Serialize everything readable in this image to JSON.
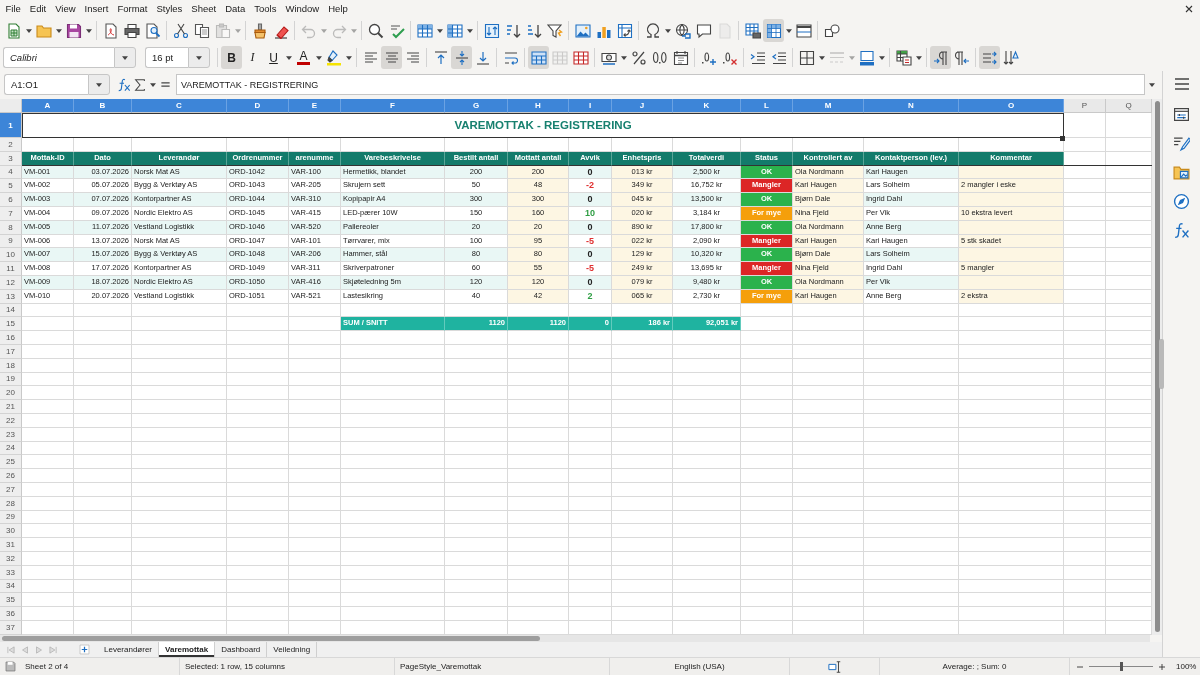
{
  "menu": [
    "File",
    "Edit",
    "View",
    "Insert",
    "Format",
    "Styles",
    "Sheet",
    "Data",
    "Tools",
    "Window",
    "Help"
  ],
  "standard_toolbar": [
    {
      "on": false,
      "disabled": false
    },
    {
      "on": false,
      "disabled": false
    },
    {
      "on": false,
      "disabled": false
    },
    {
      "on": false,
      "disabled": false
    },
    {
      "on": false,
      "disabled": false
    },
    {
      "on": false,
      "disabled": false
    },
    {
      "on": false,
      "disabled": false
    },
    {
      "on": false,
      "disabled": false
    },
    {
      "on": false,
      "disabled": true
    },
    {
      "on": false,
      "disabled": false
    },
    {
      "on": false,
      "disabled": false
    },
    {
      "on": false,
      "disabled": true
    },
    {
      "on": false,
      "disabled": true
    },
    {
      "on": false,
      "disabled": false
    },
    {
      "on": false,
      "disabled": false
    },
    {
      "on": false,
      "disabled": false
    },
    {
      "on": false,
      "disabled": false
    },
    {
      "on": false,
      "disabled": false
    },
    {
      "on": false,
      "disabled": false
    },
    {
      "on": false,
      "disabled": false
    },
    {
      "on": false,
      "disabled": false
    },
    {
      "on": false,
      "disabled": false
    },
    {
      "on": false,
      "disabled": false
    },
    {
      "on": false,
      "disabled": false
    },
    {
      "on": false,
      "disabled": false
    },
    {
      "on": false,
      "disabled": false
    },
    {
      "on": false,
      "disabled": false
    },
    {
      "on": false,
      "disabled": true
    },
    {
      "on": false,
      "disabled": false
    },
    {
      "on": true,
      "disabled": false
    },
    {
      "on": false,
      "disabled": false
    },
    {
      "on": false,
      "disabled": false
    }
  ],
  "formatting_toolbar": {
    "font_name": "Calibri",
    "font_size": "16 pt",
    "buttons": [
      {
        "label": "B",
        "on": true,
        "disabled": false
      },
      {
        "label": "I",
        "on": false,
        "disabled": false
      },
      {
        "label": "U",
        "on": false,
        "disabled": false
      },
      {
        "label": "A",
        "on": false,
        "disabled": false
      },
      {
        "on": false,
        "disabled": false
      },
      {
        "on": false,
        "disabled": false
      },
      {
        "on": true,
        "disabled": false
      },
      {
        "on": false,
        "disabled": false
      },
      {
        "on": false,
        "disabled": false
      },
      {
        "on": true,
        "disabled": false
      },
      {
        "on": false,
        "disabled": false
      },
      {
        "on": false,
        "disabled": false
      },
      {
        "on": true,
        "disabled": false
      },
      {
        "on": false,
        "disabled": true
      },
      {
        "on": false,
        "disabled": false
      },
      {
        "on": false,
        "disabled": false
      },
      {
        "on": false,
        "disabled": false
      },
      {
        "on": false,
        "disabled": false
      },
      {
        "on": false,
        "disabled": false
      },
      {
        "on": false,
        "disabled": false
      },
      {
        "on": false,
        "disabled": false
      },
      {
        "on": false,
        "disabled": false
      },
      {
        "on": false,
        "disabled": false
      },
      {
        "on": false,
        "disabled": false
      },
      {
        "on": false,
        "disabled": true
      },
      {
        "on": false,
        "disabled": false
      },
      {
        "on": false,
        "disabled": false
      },
      {
        "on": true,
        "disabled": false
      },
      {
        "on": false,
        "disabled": false
      },
      {
        "on": true,
        "disabled": false
      },
      {
        "on": false,
        "disabled": false
      }
    ]
  },
  "formula_bar": {
    "name_box": "A1:O1",
    "formula": "VAREMOTTAK - REGISTRERING"
  },
  "sheet": {
    "column_headers": [
      {
        "label": "A",
        "selected": true
      },
      {
        "label": "B",
        "selected": true
      },
      {
        "label": "C",
        "selected": true
      },
      {
        "label": "D",
        "selected": true
      },
      {
        "label": "E",
        "selected": true
      },
      {
        "label": "F",
        "selected": true
      },
      {
        "label": "G",
        "selected": true
      },
      {
        "label": "H",
        "selected": true
      },
      {
        "label": "I",
        "selected": true
      },
      {
        "label": "J",
        "selected": true
      },
      {
        "label": "K",
        "selected": true
      },
      {
        "label": "L",
        "selected": true
      },
      {
        "label": "M",
        "selected": true
      },
      {
        "label": "N",
        "selected": true
      },
      {
        "label": "O",
        "selected": true
      },
      {
        "label": "P",
        "selected": false
      },
      {
        "label": "Q",
        "selected": false
      }
    ],
    "row_headers": [
      {
        "label": "1",
        "selected": true
      },
      {
        "label": "2",
        "selected": false
      },
      {
        "label": "3",
        "selected": false
      },
      {
        "label": "4",
        "selected": false
      },
      {
        "label": "5",
        "selected": false
      },
      {
        "label": "6",
        "selected": false
      },
      {
        "label": "7",
        "selected": false
      },
      {
        "label": "8",
        "selected": false
      },
      {
        "label": "9",
        "selected": false
      },
      {
        "label": "10",
        "selected": false
      },
      {
        "label": "11",
        "selected": false
      },
      {
        "label": "12",
        "selected": false
      },
      {
        "label": "13",
        "selected": false
      },
      {
        "label": "14",
        "selected": false
      },
      {
        "label": "15",
        "selected": false
      },
      {
        "label": "16",
        "selected": false
      },
      {
        "label": "17",
        "selected": false
      },
      {
        "label": "18",
        "selected": false
      },
      {
        "label": "19",
        "selected": false
      },
      {
        "label": "20",
        "selected": false
      },
      {
        "label": "21",
        "selected": false
      },
      {
        "label": "22",
        "selected": false
      },
      {
        "label": "23",
        "selected": false
      },
      {
        "label": "24",
        "selected": false
      },
      {
        "label": "25",
        "selected": false
      },
      {
        "label": "26",
        "selected": false
      },
      {
        "label": "27",
        "selected": false
      },
      {
        "label": "28",
        "selected": false
      },
      {
        "label": "29",
        "selected": false
      },
      {
        "label": "30",
        "selected": false
      },
      {
        "label": "31",
        "selected": false
      },
      {
        "label": "32",
        "selected": false
      },
      {
        "label": "33",
        "selected": false
      },
      {
        "label": "34",
        "selected": false
      },
      {
        "label": "35",
        "selected": false
      },
      {
        "label": "36",
        "selected": false
      },
      {
        "label": "37",
        "selected": false
      }
    ],
    "title": {
      "text": "VAREMOTTAK - REGISTRERING",
      "selected": true
    },
    "columns": [
      {
        "label": "Mottak-ID",
        "kind": "data"
      },
      {
        "label": "Dato",
        "kind": "data"
      },
      {
        "label": "Leverandør",
        "kind": "data"
      },
      {
        "label": "Ordrenummer",
        "kind": "data"
      },
      {
        "label": "arenumme",
        "kind": "data"
      },
      {
        "label": "Varebeskrivelse",
        "kind": "data"
      },
      {
        "label": "Bestilt antall",
        "kind": "data"
      },
      {
        "label": "Mottatt antall",
        "kind": "input"
      },
      {
        "label": "Avvik",
        "kind": "data"
      },
      {
        "label": "Enhetspris",
        "kind": "input"
      },
      {
        "label": "Totalverdi",
        "kind": "data"
      },
      {
        "label": "Status",
        "kind": "status"
      },
      {
        "label": "Kontrollert av",
        "kind": "input"
      },
      {
        "label": "Kontaktperson (lev.)",
        "kind": "data"
      },
      {
        "label": "Kommentar",
        "kind": "input"
      }
    ],
    "rows": [
      {
        "mottak_id": "VM-001",
        "dato": "03.07.2026",
        "leverandor": "Norsk Mat AS",
        "ordrenummer": "ORD-1042",
        "varenummer": "VAR-100",
        "varebeskrivelse": "Hermetikk, blandet",
        "bestilt_antall": "200",
        "mottatt_antall": "200",
        "avvik": {
          "text": "0",
          "color": "#222222"
        },
        "enhetspris": "013 kr",
        "totalverdi": "2,500 kr",
        "status": {
          "text": "OK",
          "color": "#2bb24c"
        },
        "kontrollert_av": "Ola Nordmann",
        "kontaktperson": "Kari Haugen"
      },
      {
        "mottak_id": "VM-002",
        "dato": "05.07.2026",
        "leverandor": "Bygg & Verktøy AS",
        "ordrenummer": "ORD-1043",
        "varenummer": "VAR-205",
        "varebeskrivelse": "Skrujern sett",
        "bestilt_antall": "50",
        "mottatt_antall": "48",
        "avvik": {
          "text": "-2",
          "color": "#e03131"
        },
        "enhetspris": "349 kr",
        "totalverdi": "16,752 kr",
        "status": {
          "text": "Mangler",
          "color": "#dc2626"
        },
        "kontrollert_av": "Kari Haugen",
        "kontaktperson": "Lars Solheim",
        "kommentar": "2 mangler i eske"
      },
      {
        "mottak_id": "VM-003",
        "dato": "07.07.2026",
        "leverandor": "Kontorpartner AS",
        "ordrenummer": "ORD-1044",
        "varenummer": "VAR-310",
        "varebeskrivelse": "Kopipapir A4",
        "bestilt_antall": "300",
        "mottatt_antall": "300",
        "avvik": {
          "text": "0",
          "color": "#222222"
        },
        "enhetspris": "045 kr",
        "totalverdi": "13,500 kr",
        "status": {
          "text": "OK",
          "color": "#2bb24c"
        },
        "kontrollert_av": "Bjørn Dale",
        "kontaktperson": "Ingrid Dahl"
      },
      {
        "mottak_id": "VM-004",
        "dato": "09.07.2026",
        "leverandor": "Nordic Elektro AS",
        "ordrenummer": "ORD-1045",
        "varenummer": "VAR-415",
        "varebeskrivelse": "LED-pærer 10W",
        "bestilt_antall": "150",
        "mottatt_antall": "160",
        "avvik": {
          "text": "10",
          "color": "#2f9e44"
        },
        "enhetspris": "020 kr",
        "totalverdi": "3,184 kr",
        "status": {
          "text": "For mye",
          "color": "#f59f0b"
        },
        "kontrollert_av": "Nina Fjeld",
        "kontaktperson": "Per Vik",
        "kommentar": "10 ekstra levert"
      },
      {
        "mottak_id": "VM-005",
        "dato": "11.07.2026",
        "leverandor": "Vestland Logistikk",
        "ordrenummer": "ORD-1046",
        "varenummer": "VAR-520",
        "varebeskrivelse": "Pallereoler",
        "bestilt_antall": "20",
        "mottatt_antall": "20",
        "avvik": {
          "text": "0",
          "color": "#222222"
        },
        "enhetspris": "890 kr",
        "totalverdi": "17,800 kr",
        "status": {
          "text": "OK",
          "color": "#2bb24c"
        },
        "kontrollert_av": "Ola Nordmann",
        "kontaktperson": "Anne Berg"
      },
      {
        "mottak_id": "VM-006",
        "dato": "13.07.2026",
        "leverandor": "Norsk Mat AS",
        "ordrenummer": "ORD-1047",
        "varenummer": "VAR-101",
        "varebeskrivelse": "Tørrvarer, mix",
        "bestilt_antall": "100",
        "mottatt_antall": "95",
        "avvik": {
          "text": "-5",
          "color": "#e03131"
        },
        "enhetspris": "022 kr",
        "totalverdi": "2,090 kr",
        "status": {
          "text": "Mangler",
          "color": "#dc2626"
        },
        "kontrollert_av": "Kari Haugen",
        "kontaktperson": "Kari Haugen",
        "kommentar": "5 stk skadet"
      },
      {
        "mottak_id": "VM-007",
        "dato": "15.07.2026",
        "leverandor": "Bygg & Verktøy AS",
        "ordrenummer": "ORD-1048",
        "varenummer": "VAR-206",
        "varebeskrivelse": "Hammer, stål",
        "bestilt_antall": "80",
        "mottatt_antall": "80",
        "avvik": {
          "text": "0",
          "color": "#222222"
        },
        "enhetspris": "129 kr",
        "totalverdi": "10,320 kr",
        "status": {
          "text": "OK",
          "color": "#2bb24c"
        },
        "kontrollert_av": "Bjørn Dale",
        "kontaktperson": "Lars Solheim"
      },
      {
        "mottak_id": "VM-008",
        "dato": "17.07.2026",
        "leverandor": "Kontorpartner AS",
        "ordrenummer": "ORD-1049",
        "varenummer": "VAR-311",
        "varebeskrivelse": "Skriverpatroner",
        "bestilt_antall": "60",
        "mottatt_antall": "55",
        "avvik": {
          "text": "-5",
          "color": "#e03131"
        },
        "enhetspris": "249 kr",
        "totalverdi": "13,695 kr",
        "status": {
          "text": "Mangler",
          "color": "#dc2626"
        },
        "kontrollert_av": "Nina Fjeld",
        "kontaktperson": "Ingrid Dahl",
        "kommentar": "5 mangler"
      },
      {
        "mottak_id": "VM-009",
        "dato": "18.07.2026",
        "leverandor": "Nordic Elektro AS",
        "ordrenummer": "ORD-1050",
        "varenummer": "VAR-416",
        "varebeskrivelse": "Skjøteledning 5m",
        "bestilt_antall": "120",
        "mottatt_antall": "120",
        "avvik": {
          "text": "0",
          "color": "#222222"
        },
        "enhetspris": "079 kr",
        "totalverdi": "9,480 kr",
        "status": {
          "text": "OK",
          "color": "#2bb24c"
        },
        "kontrollert_av": "Ola Nordmann",
        "kontaktperson": "Per Vik"
      },
      {
        "mottak_id": "VM-010",
        "dato": "20.07.2026",
        "leverandor": "Vestland Logistikk",
        "ordrenummer": "ORD-1051",
        "varenummer": "VAR-521",
        "varebeskrivelse": "Lastesikring",
        "bestilt_antall": "40",
        "mottatt_antall": "42",
        "avvik": {
          "text": "2",
          "color": "#2f9e44"
        },
        "enhetspris": "065 kr",
        "totalverdi": "2,730 kr",
        "status": {
          "text": "For mye",
          "color": "#f59f0b"
        },
        "kontrollert_av": "Kari Haugen",
        "kontaktperson": "Anne Berg",
        "kommentar": "2 ekstra"
      }
    ],
    "totals": {
      "label": "SUM / SNITT",
      "bestilt_antall": "1120",
      "mottatt_antall": "1120",
      "avvik": "0",
      "enhetspris": "186 kr",
      "totalverdi": "92,051 kr"
    }
  },
  "sheet_tabs": [
    {
      "label": "Leverandører",
      "selected": false
    },
    {
      "label": "Varemottak",
      "selected": true
    },
    {
      "label": "Dashboard",
      "selected": false
    },
    {
      "label": "Veiledning",
      "selected": false
    }
  ],
  "status_bar": {
    "sheet": "Sheet 2 of 4",
    "selection": "Selected: 1 row, 15 columns",
    "page_style": "PageStyle_Varemottak",
    "language": "English (USA)",
    "summary": "Average: ; Sum: 0",
    "zoom": {
      "level": 0.5,
      "reading": "100%"
    }
  }
}
